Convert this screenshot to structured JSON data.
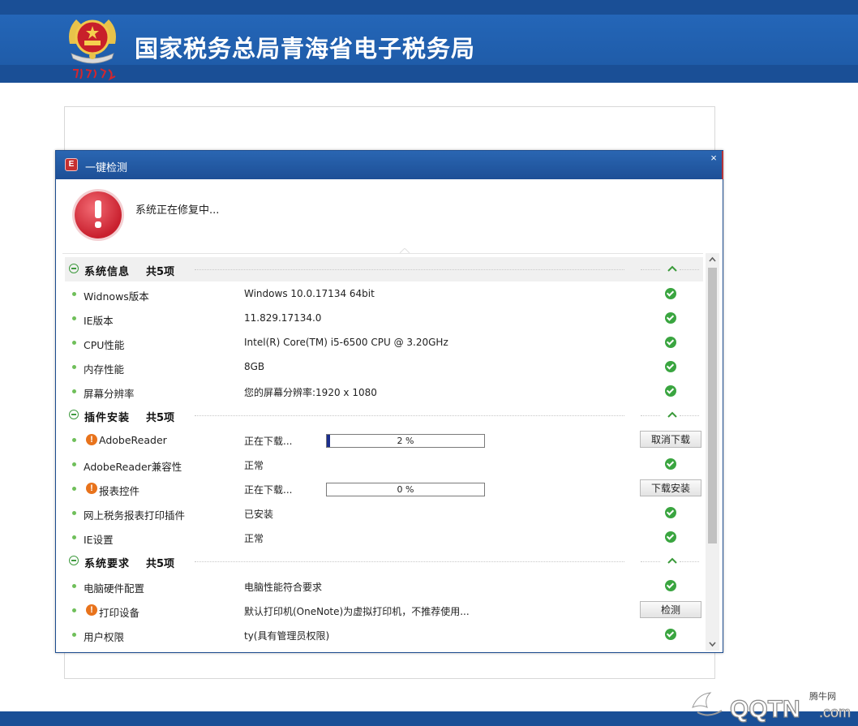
{
  "header": {
    "site_title": "国家税务总局青海省电子税务局",
    "seal_text": "中国税务"
  },
  "dialog": {
    "title": "一键检测",
    "close_glyph": "×",
    "status_text": "系统正在修复中..."
  },
  "sections": [
    {
      "title": "系统信息",
      "count": "共5项",
      "rows": [
        {
          "label": "Widnows版本",
          "value": "Windows  10.0.17134  64bit",
          "status": "ok"
        },
        {
          "label": "IE版本",
          "value": "11.829.17134.0",
          "status": "ok"
        },
        {
          "label": "CPU性能",
          "value": "Intel(R) Core(TM) i5-6500 CPU @ 3.20GHz",
          "status": "ok"
        },
        {
          "label": "内存性能",
          "value": "8GB",
          "status": "ok"
        },
        {
          "label": "屏幕分辨率",
          "value": "您的屏幕分辨率:1920 x 1080",
          "status": "ok"
        }
      ]
    },
    {
      "title": "插件安装",
      "count": "共5项",
      "rows": [
        {
          "label": "AdobeReader",
          "value": "正在下载...",
          "status": "warn",
          "progress": 2,
          "progress_label": "2 %",
          "button": "取消下载"
        },
        {
          "label": "AdobeReader兼容性",
          "value": "正常",
          "status": "ok"
        },
        {
          "label": "报表控件",
          "value": "正在下载...",
          "status": "warn",
          "progress": 0,
          "progress_label": "0 %",
          "button": "下载安装"
        },
        {
          "label": "网上税务报表打印插件",
          "value": "已安装",
          "status": "ok"
        },
        {
          "label": "IE设置",
          "value": "正常",
          "status": "ok"
        }
      ]
    },
    {
      "title": "系统要求",
      "count": "共5项",
      "rows": [
        {
          "label": "电脑硬件配置",
          "value": "电脑性能符合要求",
          "status": "ok"
        },
        {
          "label": "打印设备",
          "value": "默认打印机(OneNote)为虚拟打印机，不推荐使用...",
          "status": "warn",
          "button": "检测"
        },
        {
          "label": "用户权限",
          "value": "ty(具有管理员权限)",
          "status": "ok"
        }
      ]
    }
  ],
  "watermark": {
    "brand": "QQTN.com",
    "small": "腾牛网"
  },
  "colors": {
    "banner_blue": "#1f5ba8",
    "ok_green": "#3aa540",
    "warn_orange": "#e8731c",
    "progress_fill": "#1b2e8c",
    "danger_red": "#c9202e"
  }
}
